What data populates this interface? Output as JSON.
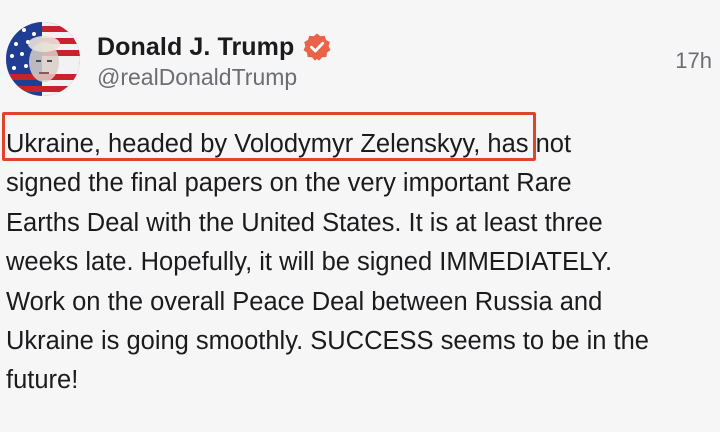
{
  "author": {
    "display_name": "Donald J. Trump",
    "handle": "@realDonaldTrump",
    "verified": true,
    "avatar_icon": "flag-portrait-avatar"
  },
  "timestamp": "17h",
  "highlight_color": "#e0442a",
  "verified_color": "#e8634a",
  "post": {
    "lines": [
      "Ukraine, headed by Volodymyr Zelenskyy, has not",
      "signed the final papers on the very important Rare",
      "Earths Deal with the United States. It is at least three",
      "weeks late. Hopefully, it will be signed IMMEDIATELY.",
      "Work on the overall Peace Deal between Russia and",
      "Ukraine is going smoothly. SUCCESS seems to be in the",
      "future!"
    ]
  }
}
